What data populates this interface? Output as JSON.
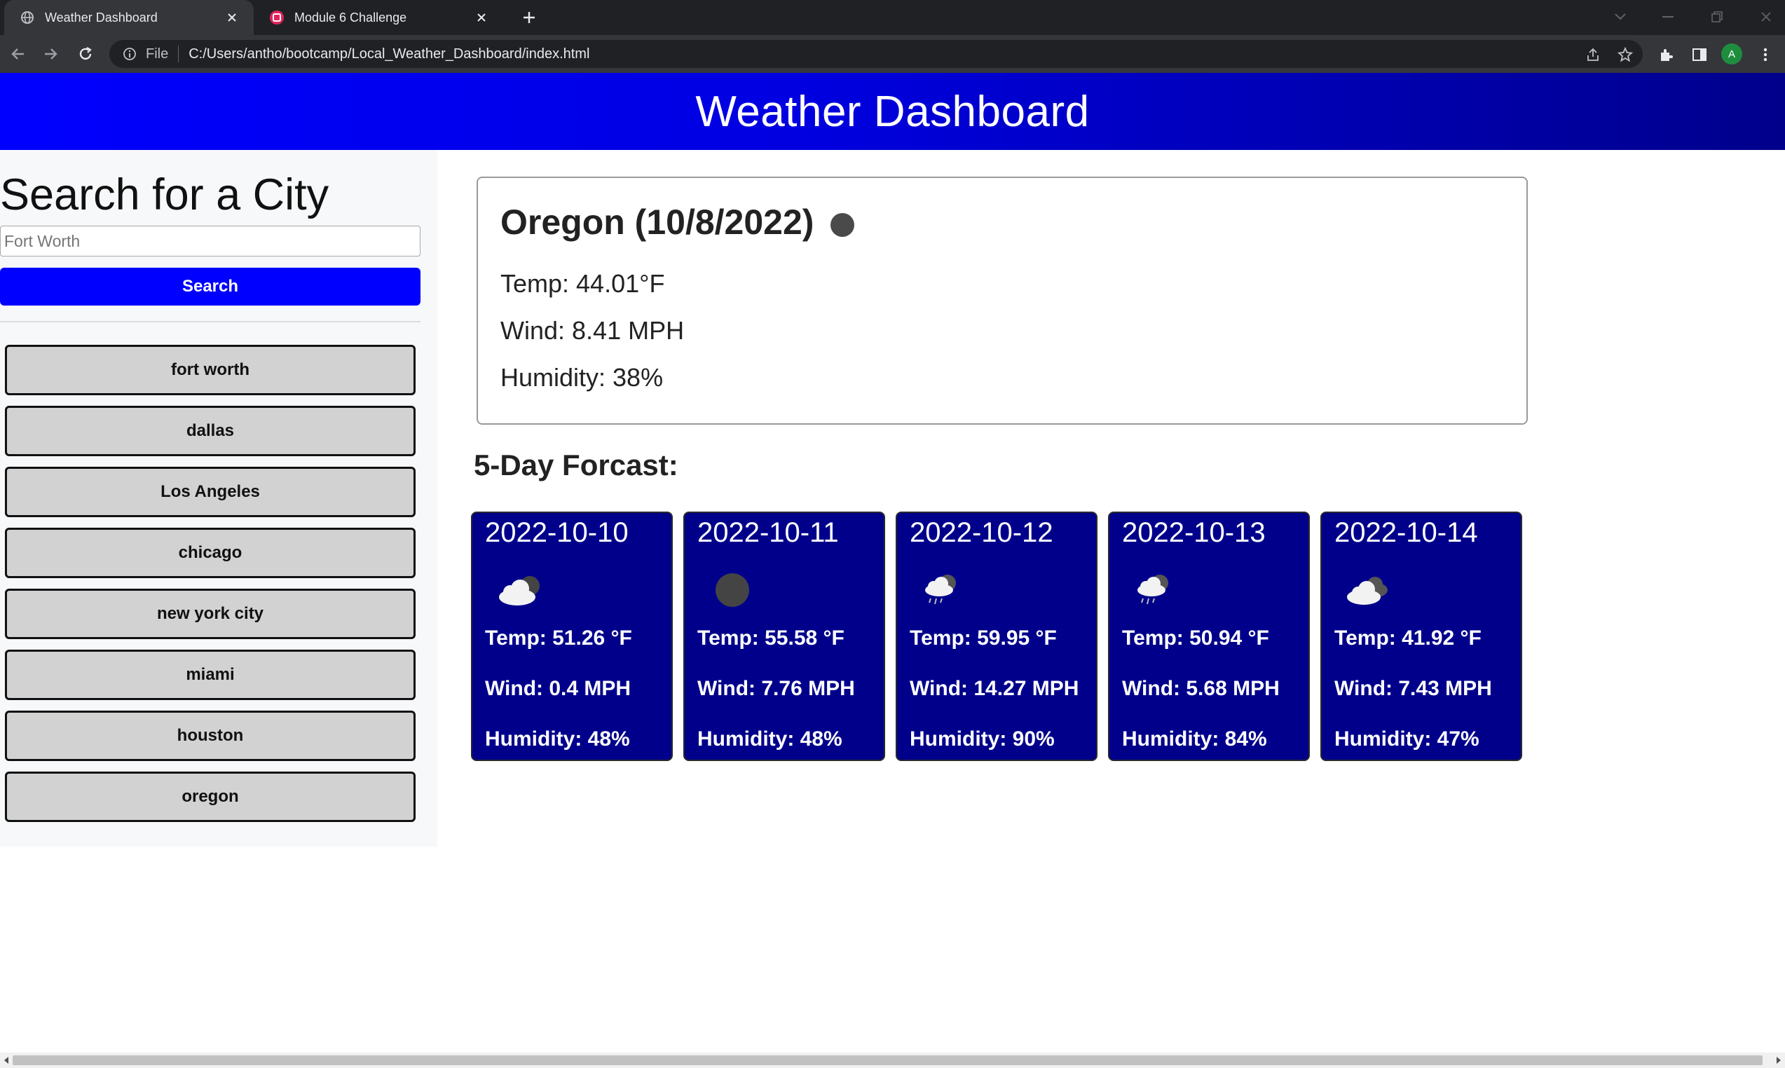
{
  "browser": {
    "tabs": [
      {
        "title": "Weather Dashboard",
        "favicon": "globe-icon",
        "active": true
      },
      {
        "title": "Module 6 Challenge",
        "favicon": "app-icon",
        "active": false
      }
    ],
    "omnibox": {
      "scheme_label": "File",
      "url": "C:/Users/antho/bootcamp/Local_Weather_Dashboard/index.html"
    },
    "profile_initial": "A"
  },
  "header": {
    "title": "Weather Dashboard"
  },
  "sidebar": {
    "search_title": "Search for a City",
    "search_placeholder": "Fort Worth",
    "search_button": "Search",
    "history": [
      "fort worth",
      "dallas",
      "Los Angeles",
      "chicago",
      "new york city",
      "miami",
      "houston",
      "oregon"
    ]
  },
  "current": {
    "title": "Oregon (10/8/2022)",
    "icon": "moon-dark-icon",
    "temp": "Temp: 44.01°F",
    "wind": "Wind: 8.41 MPH",
    "humidity": "Humidity: 38%"
  },
  "forecast": {
    "title": "5-Day Forcast:",
    "days": [
      {
        "date": "2022-10-10",
        "icon": "cloud-moon-icon",
        "temp": "Temp: 51.26 °F",
        "wind": "Wind: 0.4 MPH",
        "humidity": "Humidity: 48%"
      },
      {
        "date": "2022-10-11",
        "icon": "moon-dark-icon",
        "temp": "Temp: 55.58 °F",
        "wind": "Wind: 7.76 MPH",
        "humidity": "Humidity: 48%"
      },
      {
        "date": "2022-10-12",
        "icon": "rain-cloud-icon",
        "temp": "Temp: 59.95 °F",
        "wind": "Wind: 14.27 MPH",
        "humidity": "Humidity: 90%"
      },
      {
        "date": "2022-10-13",
        "icon": "rain-cloud-icon",
        "temp": "Temp: 50.94 °F",
        "wind": "Wind: 5.68 MPH",
        "humidity": "Humidity: 84%"
      },
      {
        "date": "2022-10-14",
        "icon": "broken-clouds-icon",
        "temp": "Temp: 41.92 °F",
        "wind": "Wind: 7.43 MPH",
        "humidity": "Humidity: 47%"
      }
    ]
  },
  "colors": {
    "header_blue": "#0000ff",
    "card_navy": "#00008b",
    "search_button": "#0000ff",
    "history_button": "#d2d2d2"
  }
}
